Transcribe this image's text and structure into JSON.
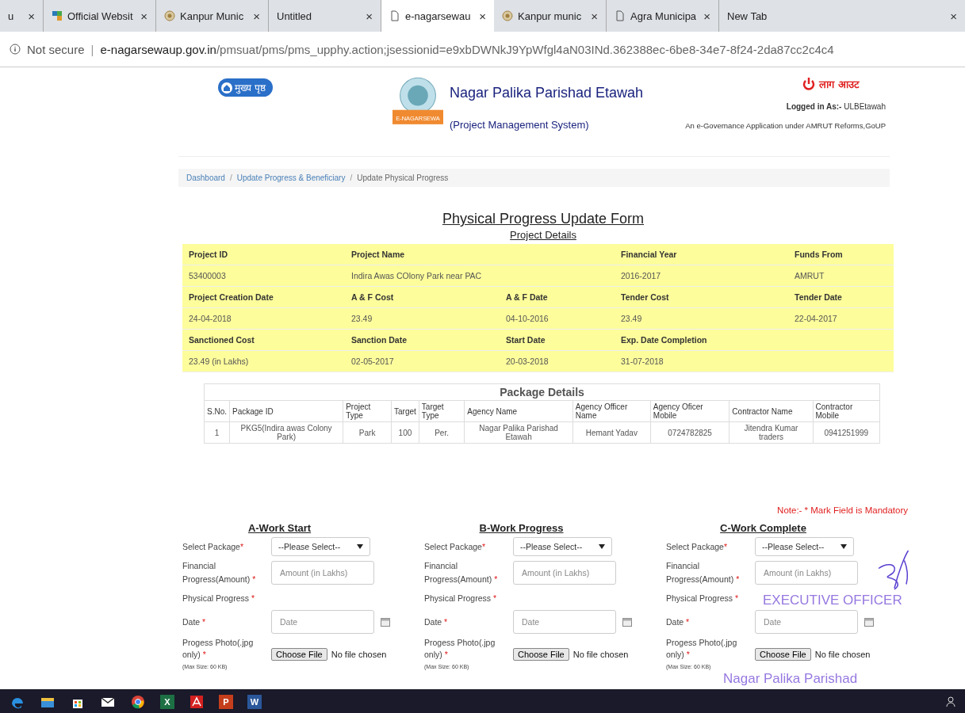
{
  "tabs": [
    {
      "label": "u",
      "selected": false
    },
    {
      "label": "Official Websit",
      "selected": false
    },
    {
      "label": "Kanpur Munic",
      "selected": false
    },
    {
      "label": "Untitled",
      "selected": false
    },
    {
      "label": "e-nagarsewau",
      "selected": true
    },
    {
      "label": "Kanpur munic",
      "selected": false
    },
    {
      "label": "Agra Municipa",
      "selected": false
    },
    {
      "label": "New Tab",
      "selected": false
    }
  ],
  "tab_close": "×",
  "address_bar": {
    "security": "Not secure",
    "separator": "|",
    "host": "e-nagarsewaup.gov.in",
    "path": "/pmsuat/pms/pms_upphy.action;jsessionid=e9xbDWNkJ9YpWfgl4aN03INd.362388ec-6be8-34e7-8f24-2da87cc2c4c4"
  },
  "header": {
    "home_button": "मुख्य पृष्ठ",
    "title": "Nagar Palika Parishad Etawah",
    "subtitle": "(Project Management System)",
    "logout": "लाग आउट",
    "logged_in_label": "Logged in As:-",
    "logged_in_user": "ULBEtawah",
    "tagline": "An e-Governance Application under AMRUT Reforms,GoUP",
    "emblem_banner": "E-NAGARSEWA"
  },
  "breadcrumb_separator": "/",
  "breadcrumb": [
    "Dashboard",
    "Update Progress & Beneficiary",
    "Update Physical Progress"
  ],
  "form_title": "Physical Progress Update Form",
  "project_details": {
    "title": "Project Details",
    "rows": [
      [
        {
          "kind": "header",
          "text": "Project ID"
        },
        {
          "kind": "header",
          "text": "Project Name"
        },
        {
          "kind": "header",
          "text": "Financial Year"
        },
        {
          "kind": "header",
          "text": "Funds From"
        }
      ],
      [
        {
          "kind": "value",
          "text": "53400003"
        },
        {
          "kind": "value",
          "text": "Indira Awas COlony Park near PAC"
        },
        {
          "kind": "value",
          "text": "2016-2017"
        },
        {
          "kind": "value",
          "text": "AMRUT"
        }
      ],
      [
        {
          "kind": "header",
          "text": "Project Creation Date"
        },
        {
          "kind": "header",
          "text": "A & F Cost"
        },
        {
          "kind": "header",
          "text": "A & F Date"
        },
        {
          "kind": "header",
          "text": "Tender Cost"
        },
        {
          "kind": "header",
          "text": "Tender Date"
        }
      ],
      [
        {
          "kind": "value",
          "text": "24-04-2018"
        },
        {
          "kind": "value",
          "text": "23.49"
        },
        {
          "kind": "value",
          "text": "04-10-2016"
        },
        {
          "kind": "value",
          "text": "23.49"
        },
        {
          "kind": "value",
          "text": "22-04-2017"
        }
      ],
      [
        {
          "kind": "header",
          "text": "Sanctioned Cost"
        },
        {
          "kind": "header",
          "text": "Sanction Date"
        },
        {
          "kind": "header",
          "text": "Start Date"
        },
        {
          "kind": "header",
          "text": "Exp. Date Completion"
        }
      ],
      [
        {
          "kind": "value",
          "text": "23.49 (in Lakhs)"
        },
        {
          "kind": "value",
          "text": "02-05-2017"
        },
        {
          "kind": "value",
          "text": "20-03-2018"
        },
        {
          "kind": "value",
          "text": "31-07-2018"
        }
      ]
    ]
  },
  "package_details": {
    "title": "Package Details",
    "columns": [
      "S.No.",
      "Package ID",
      "Project Type",
      "Target",
      "Target Type",
      "Agency Name",
      "Agency Officer Name",
      "Agency Oficer Mobile",
      "Contractor Name",
      "Contractor Mobile"
    ],
    "rows": [
      [
        "1",
        "PKG5(Indira awas Colony Park)",
        "Park",
        "100",
        "Per.",
        "Nagar Palika Parishad Etawah",
        "Hemant Yadav",
        "0724782825",
        "Jitendra Kumar traders",
        "0941251999"
      ]
    ]
  },
  "note": {
    "prefix": "Note:- ",
    "mark": "*",
    "text": " Mark Field is Mandatory"
  },
  "sections": [
    {
      "title": "A-Work Start",
      "select_label": "Select Package",
      "select_value": "--Please Select--",
      "amount_label": "Financial Progress(Amount)",
      "amount_placeholder": "Amount (in Lakhs)",
      "physical_label": "Physical Progress",
      "date_label": "Date",
      "date_placeholder": "Date",
      "photo_label": "Progess Photo(.jpg only)",
      "photo_hint": "(Max Size: 60 KB)",
      "choose_button": "Choose File",
      "no_file": "No file chosen",
      "required_mark": "*"
    },
    {
      "title": "B-Work Progress",
      "select_label": "Select Package",
      "select_value": "--Please Select--",
      "amount_label": "Financial Progress(Amount)",
      "amount_placeholder": "Amount (in Lakhs)",
      "physical_label": "Physical Progress",
      "date_label": "Date",
      "date_placeholder": "Date",
      "photo_label": "Progess Photo(.jpg only)",
      "photo_hint": "(Max Size: 60 KB)",
      "choose_button": "Choose File",
      "no_file": "No file chosen",
      "required_mark": "*"
    },
    {
      "title": "C-Work Complete",
      "select_label": "Select Package",
      "select_value": "--Please Select--",
      "amount_label": "Financial Progress(Amount)",
      "amount_placeholder": "Amount (in Lakhs)",
      "physical_label": "Physical Progress",
      "date_label": "Date",
      "date_placeholder": "Date",
      "photo_label": "Progess Photo(.jpg only)",
      "photo_hint": "(Max Size: 60 KB)",
      "choose_button": "Choose File",
      "no_file": "No file chosen",
      "required_mark": "*"
    }
  ],
  "stamp": {
    "line_1": "EXECUTIVE OFFICER",
    "line_2": "Nagar Palika Parishad"
  },
  "taskbar": [
    {
      "kind": "edge"
    },
    {
      "kind": "explorer"
    },
    {
      "kind": "store"
    },
    {
      "kind": "mail"
    },
    {
      "kind": "chrome"
    },
    {
      "kind": "excel",
      "glyph": "X"
    },
    {
      "kind": "acrobat"
    },
    {
      "kind": "powerpoint",
      "glyph": "P"
    },
    {
      "kind": "word",
      "glyph": "W"
    }
  ]
}
